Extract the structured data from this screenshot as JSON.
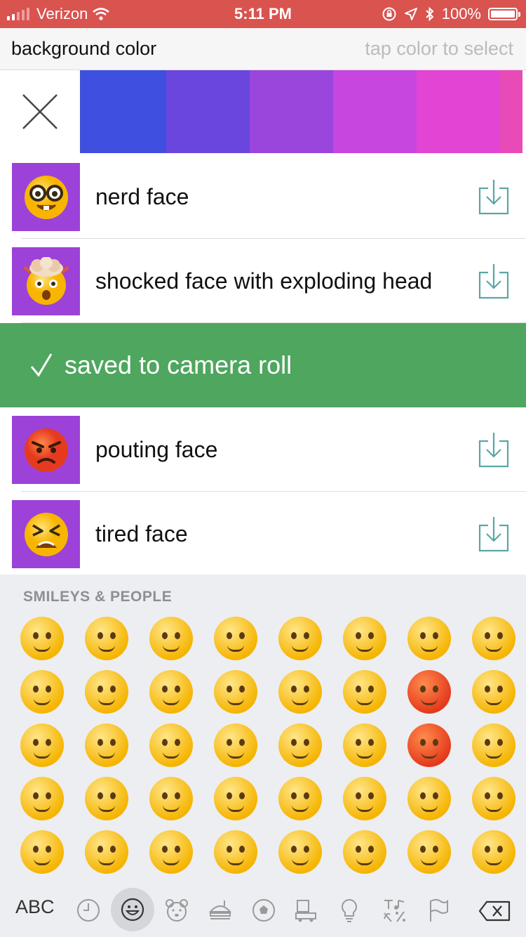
{
  "status": {
    "carrier": "Verizon",
    "time": "5:11 PM",
    "battery": "100%"
  },
  "header": {
    "title": "background color",
    "hint": "tap color to select"
  },
  "colors": [
    "#3f4fe0",
    "#6a46de",
    "#9a45dc",
    "#c746e0",
    "#e245d3",
    "#e84bb8"
  ],
  "rows": [
    {
      "label": "nerd face"
    },
    {
      "label": "shocked face with exploding head"
    },
    {
      "label": "pouting face"
    },
    {
      "label": "tired face"
    }
  ],
  "toast": {
    "message": "saved to camera roll"
  },
  "keyboard": {
    "category_title": "SMILEYS & PEOPLE",
    "abc_label": "ABC"
  }
}
